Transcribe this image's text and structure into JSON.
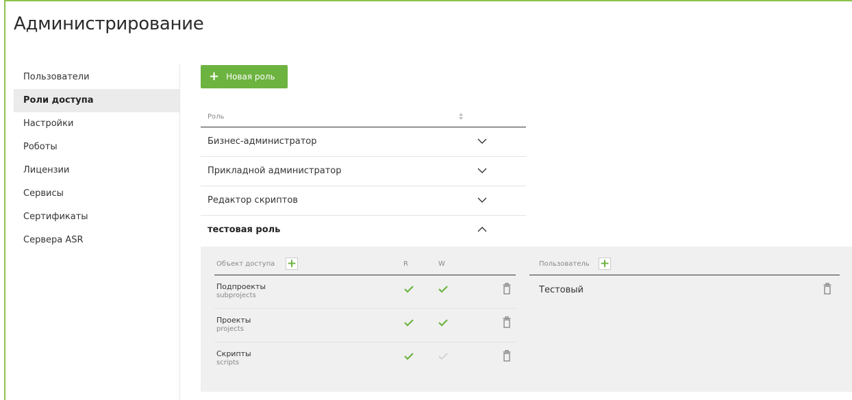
{
  "page": {
    "title": "Администрирование"
  },
  "colors": {
    "accent": "#6cb33f",
    "frame": "#8bc34a",
    "active_bg": "#ebebeb",
    "panel_bg": "#f0f0f0",
    "check_off": "#cccccc"
  },
  "sidebar": {
    "items": [
      {
        "label": "Пользователи",
        "active": false
      },
      {
        "label": "Роли доступа",
        "active": true
      },
      {
        "label": "Настройки",
        "active": false
      },
      {
        "label": "Роботы",
        "active": false
      },
      {
        "label": "Лицензии",
        "active": false
      },
      {
        "label": "Сервисы",
        "active": false
      },
      {
        "label": "Сертификаты",
        "active": false
      },
      {
        "label": "Сервера ASR",
        "active": false
      }
    ]
  },
  "toolbar": {
    "new_role_label": "Новая роль",
    "new_role_icon": "plus-icon"
  },
  "roles": {
    "header": "Роль",
    "sort_icon": "sort-icon",
    "rows": [
      {
        "label": "Бизнес-администратор",
        "expanded": false,
        "icon": "chevron-down-icon"
      },
      {
        "label": "Прикладной администратор",
        "expanded": false,
        "icon": "chevron-down-icon"
      },
      {
        "label": "Редактор скриптов",
        "expanded": false,
        "icon": "chevron-down-icon"
      },
      {
        "label": "тестовая роль",
        "expanded": true,
        "icon": "chevron-up-icon"
      }
    ]
  },
  "permissions": {
    "headers": {
      "object": "Объект доступа",
      "read": "R",
      "write": "W"
    },
    "rows": [
      {
        "name": "Подпроекты",
        "code": "subprojects",
        "read": true,
        "write": true
      },
      {
        "name": "Проекты",
        "code": "projects",
        "read": true,
        "write": true
      },
      {
        "name": "Скрипты",
        "code": "scripts",
        "read": true,
        "write": false
      }
    ]
  },
  "users": {
    "header": "Пользователь",
    "rows": [
      {
        "name": "Тестовый"
      }
    ]
  }
}
